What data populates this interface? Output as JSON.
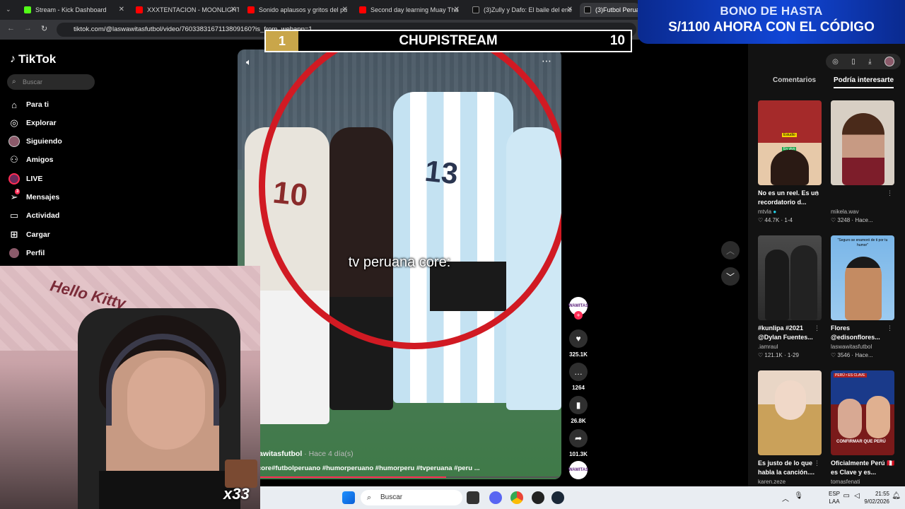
{
  "browser": {
    "tabs": [
      {
        "label": "Stream - Kick Dashboard",
        "color": "#53fc18"
      },
      {
        "label": "XXXTENTACION - MOONLIGHT",
        "color": "#ff0000"
      },
      {
        "label": "Sonido aplausos y gritos del pu",
        "color": "#ff0000"
      },
      {
        "label": "Second day learning Muay Tha",
        "color": "#ff0000"
      },
      {
        "label": "(3)Zully y Dafo: El baile del ene",
        "color": "#111111"
      },
      {
        "label": "(3)Futbol Peruano",
        "color": "#111111"
      }
    ],
    "url": "tiktok.com/@laswawitasfutbol/video/7603383167113809160?is_from_webapp=1"
  },
  "promo": {
    "line1": "BONO DE HASTA",
    "line2": "S/1100 AHORA CON EL CÓDIGO"
  },
  "scoreboard": {
    "left": "1",
    "title": "CHUPISTREAM",
    "right": "10"
  },
  "sidebar": {
    "logo": "TikTok",
    "search_placeholder": "Buscar",
    "items": [
      {
        "label": "Para ti",
        "icon": "home-icon"
      },
      {
        "label": "Explorar",
        "icon": "compass-icon"
      },
      {
        "label": "Siguiendo",
        "icon": "avatar-icon"
      },
      {
        "label": "Amigos",
        "icon": "friends-icon"
      },
      {
        "label": "LIVE",
        "icon": "live-icon"
      },
      {
        "label": "Mensajes",
        "icon": "send-icon",
        "badge": "3"
      },
      {
        "label": "Actividad",
        "icon": "inbox-icon"
      },
      {
        "label": "Cargar",
        "icon": "upload-icon"
      },
      {
        "label": "Perfil",
        "icon": "profile-icon"
      }
    ]
  },
  "video": {
    "caption": "tv peruana core:",
    "author": "awitasfutbol",
    "ago": "· Hace 4 día(s)",
    "tags": "core#futbolperuano #humorperuano #humorperu #tvperuana #peru ...",
    "progress": 0.62
  },
  "actions": {
    "avatar_label": "WAWITAS",
    "likes": "325.1K",
    "comments": "1264",
    "saves": "26.8K",
    "shares": "101.3K"
  },
  "overlay": {
    "multiplier": "x33",
    "watermark": "Hello Kitty"
  },
  "right_panel": {
    "tabs": [
      "Comentarios",
      "Podría interesarte"
    ],
    "cards": [
      {
        "title": "No es un reel. Es un recordatorio d...",
        "author": "mtvla",
        "likes": "44.7K",
        "meta": "1-4",
        "thumb_colors": [
          "#a52a2a",
          "#e7c9a9"
        ],
        "badge1": "Estudio",
        "badge2": "En vivo"
      },
      {
        "title": "",
        "author": "mikela.wav",
        "likes": "3248",
        "meta": "Hace...",
        "thumb_colors": [
          "#d8cfc4",
          "#7d1d2a"
        ]
      },
      {
        "title": "#kunlipa #2021 @Dylan Fuentes...",
        "author": ".iamraul",
        "likes": "121.1K",
        "meta": "1-29",
        "thumb_colors": [
          "#3a3a3a",
          "#777777"
        ]
      },
      {
        "title": "Flores @edisonflores...",
        "author": "laswawitasfutbol",
        "likes": "3546",
        "meta": "Hace...",
        "thumb_colors": [
          "#7ab6e8",
          "#c48b62"
        ],
        "topline": "\"Seguro se enamoró de ti por tu humor\""
      },
      {
        "title": "Es justo de lo que habla la canción....",
        "author": "karen.zeze",
        "likes": "",
        "meta": "",
        "thumb_colors": [
          "#caa15a",
          "#5a4a2a"
        ]
      },
      {
        "title": "Oficialmente Perú 🇵🇪 es Clave y es...",
        "author": "tomasfenati",
        "likes": "",
        "meta": "",
        "thumb_colors": [
          "#1a3a8a",
          "#b02020"
        ],
        "badge1": "PERÚ • ES CLAVE",
        "badge2": "CONFIRMAR QUE PERÚ"
      }
    ]
  },
  "taskbar": {
    "search": "Buscar",
    "lang": [
      "ESP",
      "LAA"
    ],
    "time": "21:55",
    "date": "9/02/2026"
  }
}
